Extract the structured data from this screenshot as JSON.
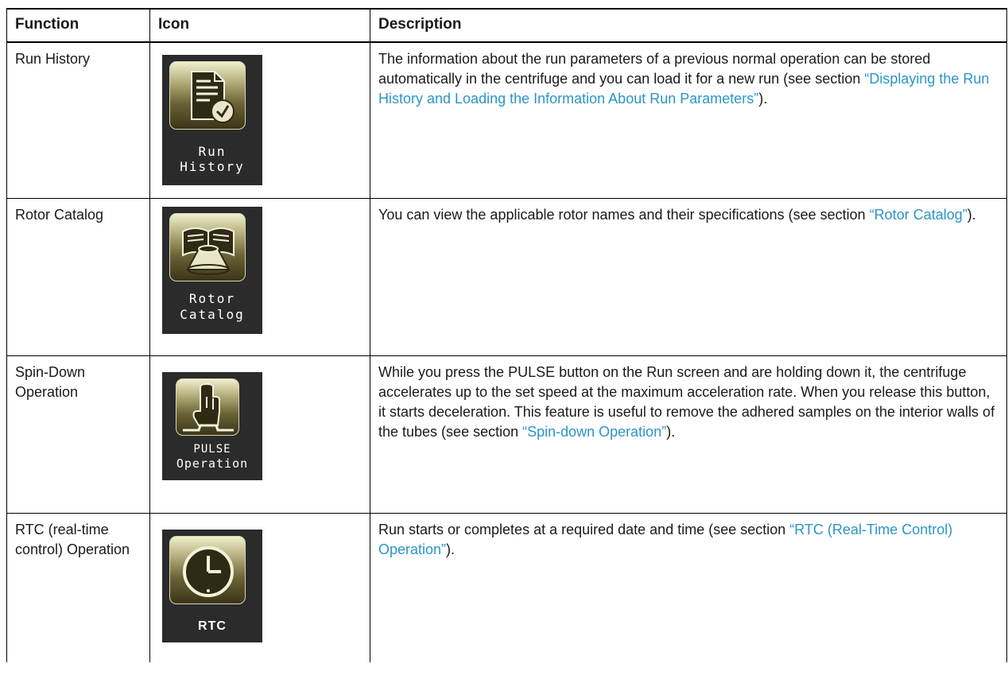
{
  "table": {
    "headers": [
      "Function",
      "Icon",
      "Description"
    ],
    "rows": [
      {
        "function": "Run History",
        "icon": {
          "name": "run-history-icon",
          "label_line1": "Run",
          "label_line2": "History"
        },
        "desc_pre": "The information about the run parameters of a previous normal operation can be stored automatically in the centrifuge and you can load it for a new run (see section ",
        "desc_link": "“Displaying the Run History and Loading the Information About Run Parameters”",
        "desc_post": ")."
      },
      {
        "function": "Rotor Catalog",
        "icon": {
          "name": "rotor-catalog-icon",
          "label_line1": "Rotor",
          "label_line2": "Catalog"
        },
        "desc_pre": "You can view the applicable rotor names and their specifications (see section ",
        "desc_link": "“Rotor Catalog”",
        "desc_post": ")."
      },
      {
        "function": "Spin-Down Operation",
        "icon": {
          "name": "pulse-operation-icon",
          "label_line1": "PULSE",
          "label_line2": "Operation"
        },
        "desc_pre": "While you press the PULSE button on the Run screen and are holding down it, the centrifuge accelerates up to the set speed at the maximum acceleration rate. When you release this button, it starts deceleration. This feature is useful to remove the adhered samples on the interior walls of the tubes (see section ",
        "desc_link": "“Spin-down Operation”",
        "desc_post": ")."
      },
      {
        "function": "RTC (real-time control) Operation",
        "icon": {
          "name": "rtc-clock-icon",
          "label_line1": "RTC"
        },
        "desc_pre": "Run starts or completes at a required date and time (see section ",
        "desc_link": "“RTC (Real-Time Control) Operation”",
        "desc_post": ")."
      }
    ]
  },
  "colors": {
    "link": "#2b95c8",
    "icon_bg": "#2b2b2b",
    "icon_face": "#8a8350"
  }
}
